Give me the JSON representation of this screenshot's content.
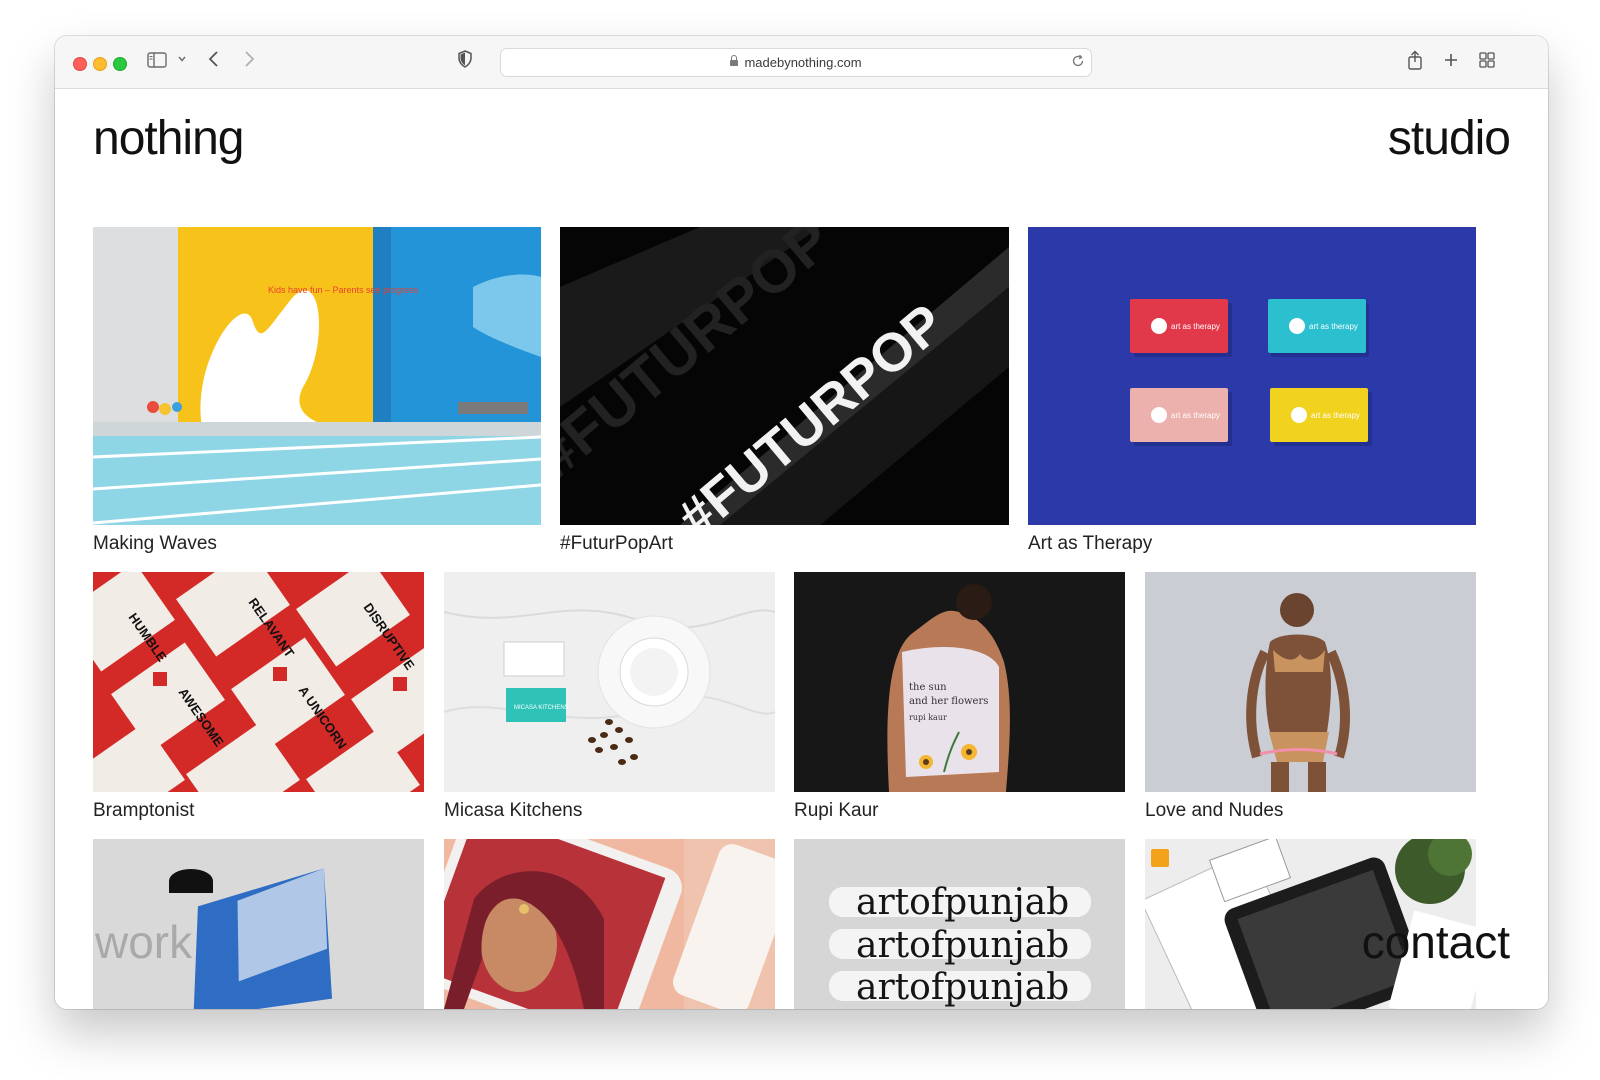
{
  "browser": {
    "url": "madebynothing.com"
  },
  "header": {
    "logo_left": "nothing",
    "logo_right": "studio"
  },
  "projects_row1": [
    {
      "title": "Making Waves"
    },
    {
      "title": "#FuturPopArt"
    },
    {
      "title": "Art as Therapy"
    }
  ],
  "projects_row2": [
    {
      "title": "Bramptonist"
    },
    {
      "title": "Micasa Kitchens"
    },
    {
      "title": "Rupi Kaur"
    },
    {
      "title": "Love and Nudes"
    }
  ],
  "image_text": {
    "pool_tagline": "Kids have fun – Parents see progress",
    "card_label": "art as therapy",
    "tote_words": [
      "HUMBLE",
      "RELAVANT",
      "DISRUPTIVE",
      "AWESOME",
      "A UNICORN"
    ],
    "business_card": "MICASA KITCHENS",
    "back_text_1": "the sun",
    "back_text_2": "and her flowers",
    "back_text_3": "rupi kaur",
    "punjab": "artofpunjab"
  },
  "footer_nav": {
    "work": "work",
    "contact": "contact"
  },
  "colors": {
    "pool_yellow": "#f7c21a",
    "pool_blue": "#2394d8",
    "therapy_blue": "#2b3aa8",
    "tote_red": "#d42a27",
    "card_red": "#e2394a",
    "card_teal": "#2bbfcf",
    "card_pink": "#ecb0ad",
    "card_yellow": "#f0d21f"
  }
}
